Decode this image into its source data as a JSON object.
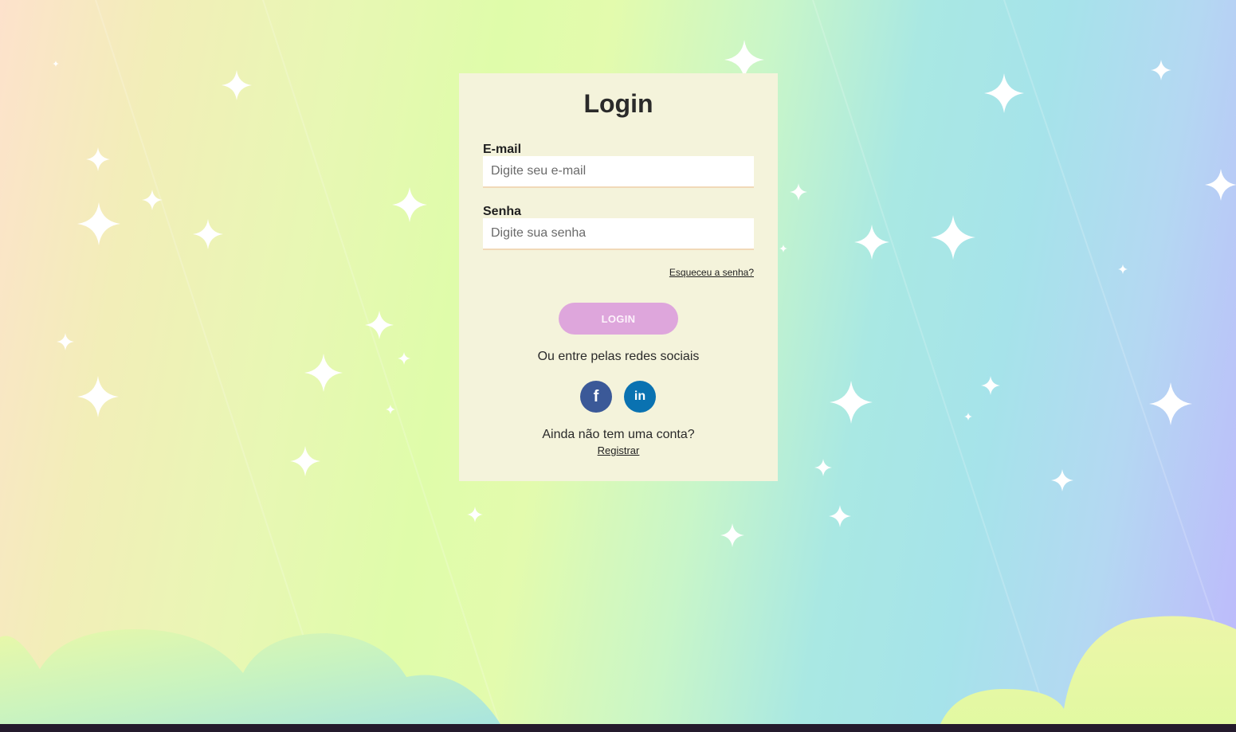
{
  "login": {
    "title": "Login",
    "email_label": "E-mail",
    "email_placeholder": "Digite seu e-mail",
    "password_label": "Senha",
    "password_placeholder": "Digite sua senha",
    "forgot_link": "Esqueceu a senha?",
    "login_button": "LOGIN",
    "social_text": "Ou entre pelas redes sociais",
    "social": [
      {
        "icon": "facebook-icon",
        "glyph": "f",
        "color": "#3b5998"
      },
      {
        "icon": "linkedin-icon",
        "glyph": "in",
        "color": "#0a72b1"
      }
    ],
    "no_account_text": "Ainda não tem uma conta?",
    "register_link": "Registrar"
  },
  "colors": {
    "card_bg": "#f4f3db",
    "button": "#dea6dc"
  }
}
